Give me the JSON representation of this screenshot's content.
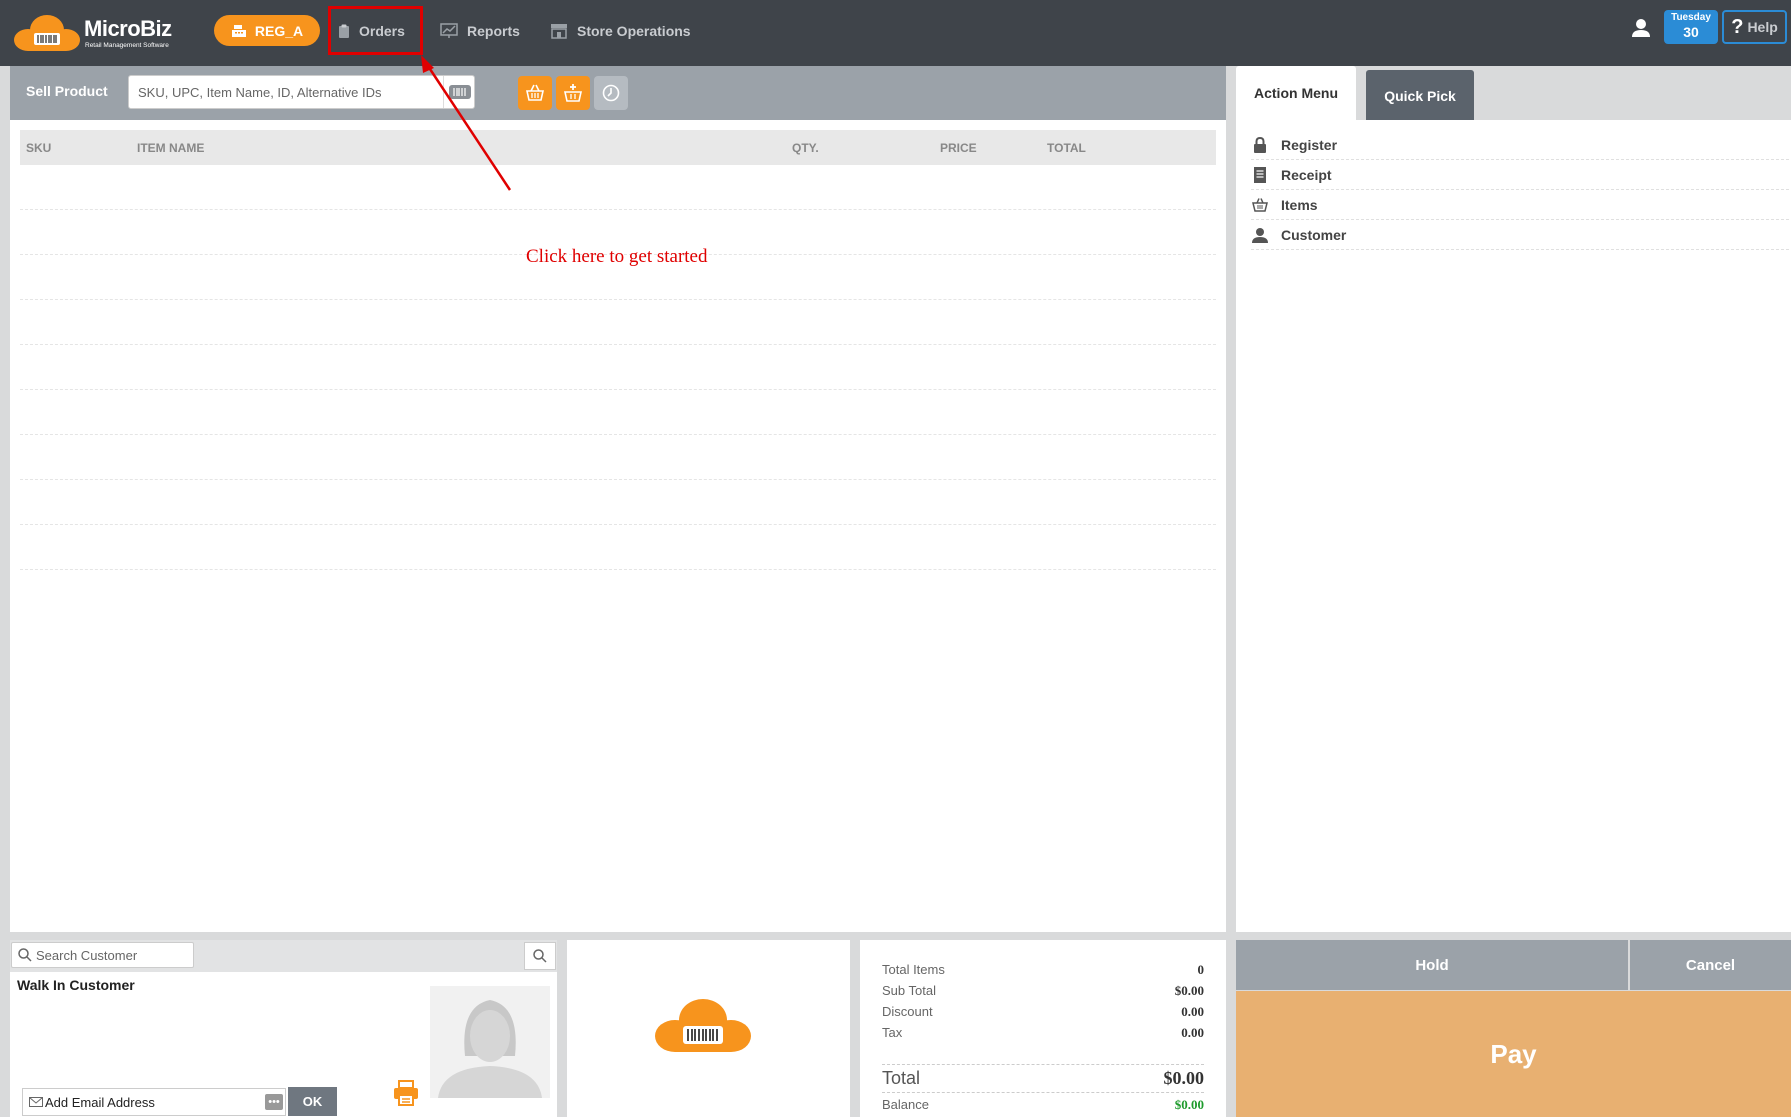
{
  "header": {
    "logo_text": "MicroBiz",
    "logo_subtitle": "Retail Management Software",
    "register_label": "REG_A",
    "nav": [
      {
        "label": "Orders",
        "icon": "clipboard-icon"
      },
      {
        "label": "Reports",
        "icon": "chart-icon"
      },
      {
        "label": "Store Operations",
        "icon": "store-icon"
      }
    ],
    "date_day": "Tuesday",
    "date_num": "30",
    "help_label": "Help"
  },
  "sell": {
    "label": "Sell Product",
    "search_placeholder": "SKU, UPC, Item Name, ID, Alternative IDs"
  },
  "table": {
    "columns": [
      "SKU",
      "ITEM NAME",
      "QTY.",
      "PRICE",
      "TOTAL"
    ],
    "empty_rows": 9
  },
  "annotation": {
    "text": "Click here to get started",
    "color": "#e00000"
  },
  "right_panel": {
    "tabs": [
      "Action Menu",
      "Quick Pick"
    ],
    "actions": [
      {
        "label": "Register",
        "icon": "lock-icon"
      },
      {
        "label": "Receipt",
        "icon": "receipt-icon"
      },
      {
        "label": "Items",
        "icon": "basket-icon"
      },
      {
        "label": "Customer",
        "icon": "user-icon"
      }
    ]
  },
  "customer": {
    "search_placeholder": "Search Customer",
    "name": "Walk In Customer",
    "email_placeholder": "Add Email Address",
    "email_dots": "•••",
    "ok_label": "OK"
  },
  "totals": {
    "total_items_label": "Total Items",
    "total_items": "0",
    "subtotal_label": "Sub Total",
    "subtotal": "$0.00",
    "discount_label": "Discount",
    "discount": "0.00",
    "tax_label": "Tax",
    "tax": "0.00",
    "total_label": "Total",
    "total": "$0.00",
    "balance_label": "Balance",
    "balance": "$0.00"
  },
  "actions": {
    "hold": "Hold",
    "cancel": "Cancel",
    "pay": "Pay"
  },
  "colors": {
    "brand_orange": "#f7941d",
    "topbar": "#3f444a",
    "accent_blue": "#2b8cd6",
    "pay": "#e8b071"
  }
}
